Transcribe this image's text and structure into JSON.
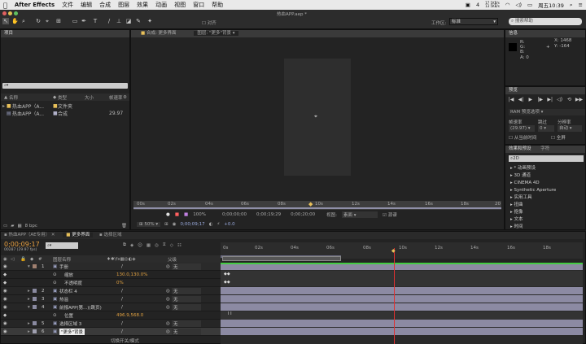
{
  "menubar": {
    "apple": "",
    "app": "After Effects",
    "items": [
      "文件",
      "编辑",
      "合成",
      "图层",
      "效果",
      "动画",
      "视图",
      "窗口",
      "帮助"
    ],
    "battery": "4",
    "network": "17 1KB/s\n13 5KB/s",
    "clock": "周五10:39",
    "window_title": "热血APP.aep *"
  },
  "toolbar": {
    "snap_label": "对齐",
    "workspace_label": "工作区:",
    "workspace_value": "标准",
    "search_placeholder": "搜索帮助"
  },
  "project": {
    "tab": "项目",
    "search_placeholder": "",
    "columns": [
      "名称",
      "类型",
      "大小",
      "帧速率"
    ],
    "items": [
      {
        "name": "热血APP（A...",
        "type": "文件夹",
        "size": "",
        "fps": ""
      },
      {
        "name": "热血APP（A...",
        "type": "合成",
        "size": "",
        "fps": "29.97"
      }
    ],
    "bpc": "8 bpc"
  },
  "composition": {
    "tab1": "合成: 更多界面",
    "tab2": "图层: \"更多\"背景",
    "zoom": "50%",
    "timecode": "0;00;09;17",
    "start": "0;00;00;00",
    "end": "0;00;19;29",
    "duration": "0;00;20;00",
    "view_label": "视图:",
    "view_value": "素面",
    "guide_label": "源谱",
    "plus": "+0.0",
    "ruler_labels": [
      "00s",
      "02s",
      "04s",
      "06s",
      "08s",
      "10s",
      "12s",
      "14s",
      "16s",
      "18s",
      "20"
    ],
    "zoom2": "100%"
  },
  "info": {
    "tab": "信息",
    "r": "R:",
    "g": "G:",
    "b": "B:",
    "a": "A:  0",
    "x": "X: 1468",
    "y": "Y: -164"
  },
  "preview": {
    "tab": "预览",
    "ram_label": "RAM 预览选项",
    "fps_label": "帧速率",
    "skip_label": "跳过",
    "res_label": "分辨率",
    "fps_value": "(29.97)",
    "skip_value": "0",
    "res_value": "自动",
    "from_current": "从当前时间",
    "fullscreen": "全屏"
  },
  "effects": {
    "tab1": "效果和预设",
    "tab2": "字符",
    "search": "2D",
    "items": [
      "* 动画预设",
      "3D 通道",
      "CINEMA 4D",
      "Synthetic Aperture",
      "实用工具",
      "扭曲",
      "抠像",
      "文本",
      "时间"
    ]
  },
  "timeline": {
    "tabs": [
      "热血APP（AE专用）",
      "更多界面",
      "选择区域"
    ],
    "timecode": "0;00;09;17",
    "frames": "00287 (29.97 fps)",
    "cols": [
      "图层名称",
      "父级"
    ],
    "ruler": [
      "0s",
      "02s",
      "04s",
      "06s",
      "08s",
      "10s",
      "12s",
      "14s",
      "16s",
      "18s"
    ],
    "toggle_label": "切换开关/模式",
    "layers": [
      {
        "num": "1",
        "name": "手册",
        "color": "#a08070",
        "parent": "无"
      },
      {
        "num": "",
        "name": "缩放",
        "value": "130.0,130.0%",
        "prop": true
      },
      {
        "num": "",
        "name": "不透明度",
        "value": "0%",
        "prop": true
      },
      {
        "num": "2",
        "name": "状态栏 4",
        "color": "#8a8aa0",
        "parent": "无"
      },
      {
        "num": "3",
        "name": "热溢",
        "color": "#8a8aa0",
        "parent": "无"
      },
      {
        "num": "4",
        "name": "前报APP(第...)(跳页)",
        "color": "#8a8aa0",
        "parent": "无"
      },
      {
        "num": "",
        "name": "位置",
        "value": "496.9,568.0",
        "prop": true
      },
      {
        "num": "5",
        "name": "选择区域 3",
        "color": "#8a8aa0",
        "parent": "无"
      },
      {
        "num": "6",
        "name": "\"更多\"背景",
        "color": "#a0a0b0",
        "parent": "无"
      }
    ]
  }
}
